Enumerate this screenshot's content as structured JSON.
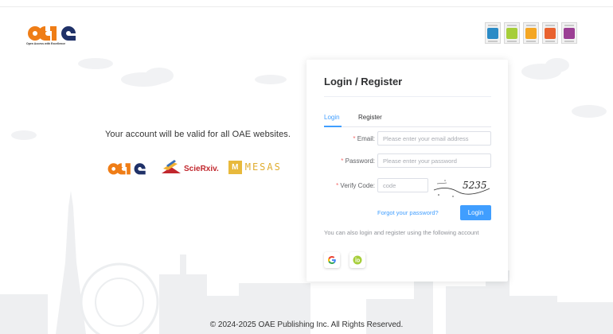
{
  "header": {
    "logo_tagline": "Open Access with Excellence",
    "badges": [
      {
        "icon": "fingerprint-badge-icon",
        "color": "#2b8bc6"
      },
      {
        "icon": "orcid-id-badge-icon",
        "color": "#a6ce39"
      },
      {
        "icon": "download-badge-icon",
        "color": "#f4a623"
      },
      {
        "icon": "puzzle-badge-icon",
        "color": "#e9622f"
      },
      {
        "icon": "refresh-badge-icon",
        "color": "#9b3f94"
      }
    ]
  },
  "left": {
    "valid_text": "Your account will be valid for all OAE websites.",
    "partners": {
      "sciexiv_label": "ScieRxiv.",
      "mesas_label": "MESAS",
      "mesas_glyph": "M"
    }
  },
  "card": {
    "title": "Login / Register",
    "tabs": {
      "login": "Login",
      "register": "Register"
    },
    "email": {
      "label": "Email:",
      "required_mark": "*",
      "placeholder": "Please enter your email address",
      "value": ""
    },
    "password": {
      "label": "Password:",
      "required_mark": "*",
      "placeholder": "Please enter your password",
      "value": ""
    },
    "verify": {
      "label": "Verify Code:",
      "required_mark": "*",
      "placeholder": "code",
      "value": "",
      "captcha_text": "5235"
    },
    "forgot_link": "Forgot your password?",
    "login_button": "Login",
    "alt_login_text": "You can also login and register using the following account",
    "social": [
      {
        "name": "google",
        "glyph": "G"
      },
      {
        "name": "orcid",
        "glyph": "iD"
      }
    ]
  },
  "footer": {
    "copyright": "© 2024-2025 OAE Publishing Inc. All Rights Reserved."
  },
  "colors": {
    "brand_orange": "#ef7d16",
    "brand_navy": "#1f3168",
    "primary_blue": "#409eff",
    "required_red": "#f56c6c"
  }
}
